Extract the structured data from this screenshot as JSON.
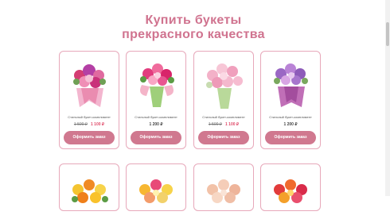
{
  "heading": {
    "line1": "Купить букеты",
    "line2": "прекрасного качества"
  },
  "products": [
    {
      "name": "Стильный букет-комплимент",
      "old_price": "1 500 ₽",
      "price": "1 100 ₽",
      "button": "Оформить заказ"
    },
    {
      "name": "Стильный букет-комплимент",
      "price": "1 200 ₽",
      "button": "Оформить заказ"
    },
    {
      "name": "Стильный букет-комплимент",
      "old_price": "1 500 ₽",
      "price": "1 100 ₽",
      "button": "Оформить заказ"
    },
    {
      "name": "Стильный букет-комплимент",
      "price": "1 200 ₽",
      "button": "Оформить заказ"
    }
  ],
  "colors": {
    "accent": "#d0738f",
    "button": "#d0788f",
    "card_border": "#e7a8ba",
    "sale_price": "#e04c6b"
  }
}
